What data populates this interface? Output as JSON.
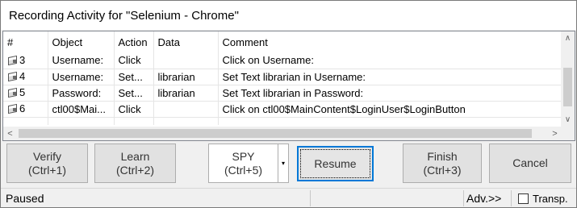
{
  "window": {
    "title": "Recording Activity for \"Selenium - Chrome\""
  },
  "grid": {
    "columns": [
      "#",
      "Object",
      "Action",
      "Data",
      "Comment"
    ],
    "rows": [
      {
        "num": "3",
        "object": "Username:",
        "action": "Click",
        "data": "",
        "comment": "Click on Username:"
      },
      {
        "num": "4",
        "object": "Username:",
        "action": "Set...",
        "data": "librarian",
        "comment": "Set Text librarian in Username:"
      },
      {
        "num": "5",
        "object": "Password:",
        "action": "Set...",
        "data": "librarian",
        "comment": "Set Text librarian in Password:"
      },
      {
        "num": "6",
        "object": "ctl00$Mai...",
        "action": "Click",
        "data": "",
        "comment": "Click on ctl00$MainContent$LoginUser$LoginButton"
      }
    ],
    "row_icon": "recorded-step-icon",
    "scroll": {
      "up_arrow": "∧",
      "down_arrow": "∨",
      "left_arrow": "<",
      "right_arrow": ">"
    }
  },
  "buttons": {
    "verify": {
      "line1": "Verify",
      "line2": "(Ctrl+1)"
    },
    "learn": {
      "line1": "Learn",
      "line2": "(Ctrl+2)"
    },
    "spy": {
      "line1": "SPY",
      "line2": "(Ctrl+5)"
    },
    "spy_dropdown": "▾",
    "resume": {
      "line1": "Resume"
    },
    "finish": {
      "line1": "Finish",
      "line2": "(Ctrl+3)"
    },
    "cancel": {
      "line1": "Cancel"
    }
  },
  "status": {
    "state": "Paused",
    "advanced": "Adv.>>",
    "transparent_label": "Transp.",
    "transparent_checked": false
  }
}
